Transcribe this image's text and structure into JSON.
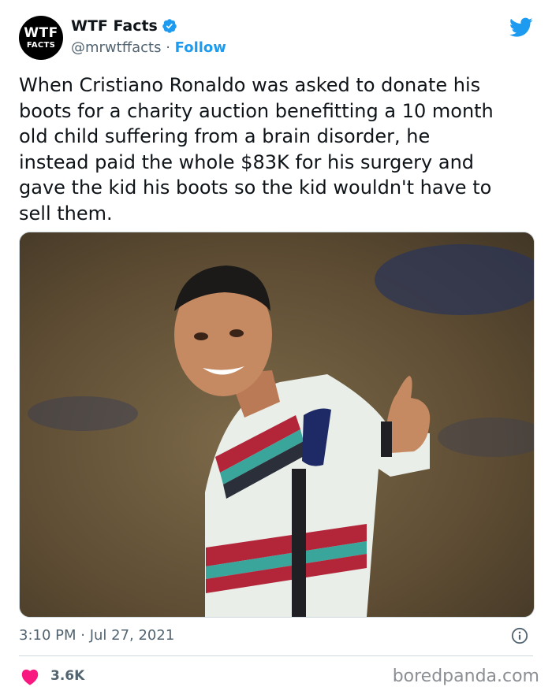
{
  "account": {
    "avatar_line1": "WTF",
    "avatar_line2": "FACTS",
    "display_name": "WTF Facts",
    "handle": "@mrwtffacts",
    "separator": " · ",
    "follow_label": "Follow"
  },
  "tweet": {
    "text": "When Cristiano Ronaldo was asked to donate his\nboots for a charity auction benefitting a 10 month\nold child suffering from a brain disorder, he\ninstead paid the whole $83K for his surgery and\ngave the kid his boots so the kid wouldn't have to\nsell them.",
    "timestamp": "3:10 PM · Jul 27, 2021",
    "like_count": "3.6K"
  },
  "icons": {
    "verified": "verified-badge-icon",
    "twitter": "twitter-bird-icon",
    "info": "info-icon",
    "heart": "heart-icon"
  },
  "colors": {
    "twitter_blue": "#1d9bf0",
    "heart": "#f91880",
    "muted": "#536471"
  },
  "watermark": "boredpanda.com"
}
